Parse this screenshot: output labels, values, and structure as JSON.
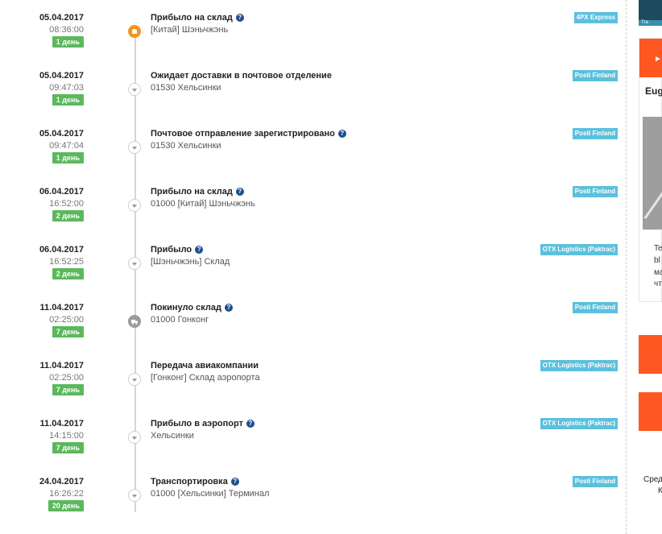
{
  "events": [
    {
      "date": "05.04.2017",
      "time": "08:36:00",
      "days": "1 день",
      "days_color": "#5cb85c",
      "title": "Прибыло на склад",
      "has_help": true,
      "location": "[Китай] Шэньчжэнь",
      "carrier": "4PX Express",
      "marker": "box-icon"
    },
    {
      "date": "05.04.2017",
      "time": "09:47:03",
      "days": "1 день",
      "days_color": "#5cb85c",
      "title": "Ожидает доставки в почтовое отделение",
      "has_help": false,
      "location": "01530 Хельсинки",
      "carrier": "Posti Finland",
      "marker": "arrow-down-icon"
    },
    {
      "date": "05.04.2017",
      "time": "09:47:04",
      "days": "1 день",
      "days_color": "#5cb85c",
      "title": "Почтовое отправление зарегистрировано",
      "has_help": true,
      "location": "01530 Хельсинки",
      "carrier": "Posti Finland",
      "marker": "arrow-down-icon"
    },
    {
      "date": "06.04.2017",
      "time": "16:52:00",
      "days": "2 день",
      "days_color": "#5cb85c",
      "title": "Прибыло на склад",
      "has_help": true,
      "location": "01000 [Китай] Шэньчжэнь",
      "carrier": "Posti Finland",
      "marker": "arrow-down-icon"
    },
    {
      "date": "06.04.2017",
      "time": "16:52:25",
      "days": "2 день",
      "days_color": "#5cb85c",
      "title": "Прибыло",
      "has_help": true,
      "location": "[Шэньчжэнь] Склад",
      "carrier": "OTX Logistics (Paktrac)",
      "marker": "arrow-down-icon"
    },
    {
      "date": "11.04.2017",
      "time": "02:25:00",
      "days": "7 день",
      "days_color": "#5cb85c",
      "title": "Покинуло склад",
      "has_help": true,
      "location": "01000 Гонконг",
      "carrier": "Posti Finland",
      "marker": "truck-icon"
    },
    {
      "date": "11.04.2017",
      "time": "02:25:00",
      "days": "7 день",
      "days_color": "#5cb85c",
      "title": "Передача авиакомпании",
      "has_help": false,
      "location": "[Гонконг] Склад аэропорта",
      "carrier": "OTX Logistics (Paktrac)",
      "marker": "arrow-down-icon"
    },
    {
      "date": "11.04.2017",
      "time": "14:15:00",
      "days": "7 день",
      "days_color": "#5cb85c",
      "title": "Прибыло в аэропорт",
      "has_help": true,
      "location": "Хельсинки",
      "carrier": "OTX Logistics (Paktrac)",
      "marker": "arrow-down-icon"
    },
    {
      "date": "24.04.2017",
      "time": "16:26:22",
      "days": "20 день",
      "days_color": "#5cb85c",
      "title": "Транспортировка",
      "has_help": true,
      "location": "01000 [Хельсинки] Терминал",
      "carrier": "Posti Finland",
      "marker": "arrow-down-icon"
    }
  ],
  "help_glyph": "?",
  "colors": {
    "carrier_badge": "#5bc0de",
    "accent_orange": "#ff5722",
    "marker_orange": "#f7931e"
  },
  "sidebar": {
    "top_banner_text": "Tra",
    "card_name": "Eug",
    "card_lines": [
      "Te",
      "bl",
      "ма",
      "чт"
    ],
    "bottom_text": [
      "Сред",
      "К"
    ]
  }
}
